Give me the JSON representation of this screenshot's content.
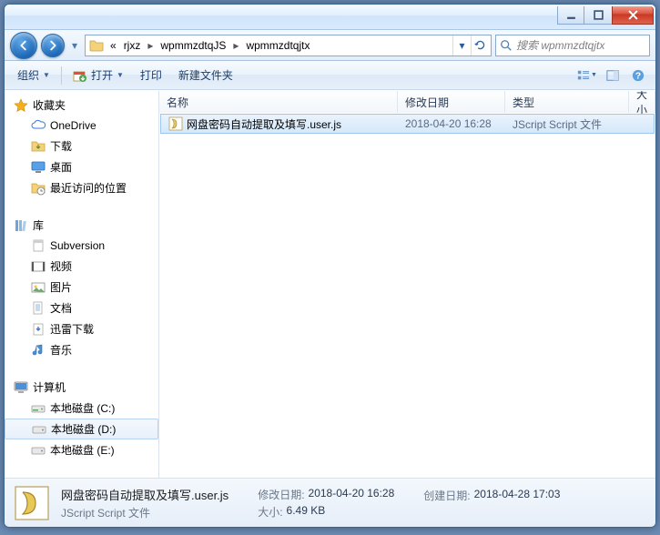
{
  "breadcrumb": {
    "prefix": "«",
    "items": [
      "rjxz",
      "wpmmzdtqJS",
      "wpmmzdtqjtx"
    ]
  },
  "search": {
    "placeholder": "搜索 wpmmzdtqjtx"
  },
  "toolbar": {
    "organize": "组织",
    "open": "打开",
    "print": "打印",
    "new_folder": "新建文件夹"
  },
  "sidebar": {
    "favorites": {
      "label": "收藏夹",
      "items": [
        {
          "label": "OneDrive"
        },
        {
          "label": "下载"
        },
        {
          "label": "桌面"
        },
        {
          "label": "最近访问的位置"
        }
      ]
    },
    "libraries": {
      "label": "库",
      "items": [
        {
          "label": "Subversion"
        },
        {
          "label": "视频"
        },
        {
          "label": "图片"
        },
        {
          "label": "文档"
        },
        {
          "label": "迅雷下载"
        },
        {
          "label": "音乐"
        }
      ]
    },
    "computer": {
      "label": "计算机",
      "items": [
        {
          "label": "本地磁盘 (C:)"
        },
        {
          "label": "本地磁盘 (D:)"
        },
        {
          "label": "本地磁盘 (E:)"
        }
      ]
    }
  },
  "columns": {
    "name": "名称",
    "date": "修改日期",
    "type": "类型",
    "size": "大小"
  },
  "files": [
    {
      "name": "网盘密码自动提取及填写.user.js",
      "date": "2018-04-20 16:28",
      "type": "JScript Script 文件"
    }
  ],
  "details": {
    "filename": "网盘密码自动提取及填写.user.js",
    "filetype": "JScript Script 文件",
    "mod_label": "修改日期:",
    "mod_value": "2018-04-20 16:28",
    "size_label": "大小:",
    "size_value": "6.49 KB",
    "created_label": "创建日期:",
    "created_value": "2018-04-28 17:03"
  }
}
